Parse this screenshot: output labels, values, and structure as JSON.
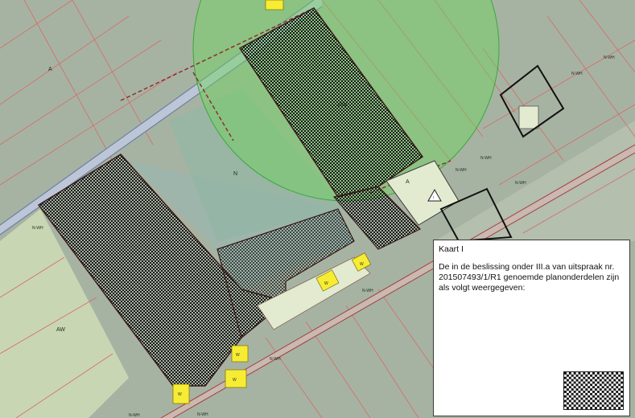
{
  "map": {
    "zone_labels": [
      {
        "id": "a-top-left",
        "text": "A"
      },
      {
        "id": "a-parcel",
        "text": "A"
      },
      {
        "id": "n-center",
        "text": "N"
      },
      {
        "id": "aw-left",
        "text": "AW"
      },
      {
        "id": "aw-upper",
        "text": "AW"
      },
      {
        "id": "nwh-top-right",
        "text": "N-WH"
      },
      {
        "id": "nwh-right",
        "text": "N-WH"
      },
      {
        "id": "nwh-mid1",
        "text": "N-WH"
      },
      {
        "id": "nwh-mid2",
        "text": "N-WH"
      },
      {
        "id": "nwh-far-right",
        "text": "N-WH"
      },
      {
        "id": "nwh-left",
        "text": "N-WH"
      },
      {
        "id": "nwh-road",
        "text": "N-WH"
      },
      {
        "id": "nwh-bottom",
        "text": "N-WH"
      },
      {
        "id": "nwh-bottom2",
        "text": "N-WH"
      },
      {
        "id": "nwh-bottom3",
        "text": "N-WH"
      },
      {
        "id": "w-1",
        "text": "W"
      },
      {
        "id": "w-2",
        "text": "W"
      },
      {
        "id": "w-3",
        "text": "W"
      },
      {
        "id": "w-4",
        "text": "W"
      },
      {
        "id": "w-5",
        "text": "W"
      }
    ],
    "colors": {
      "background": "#a7b3a2",
      "agri_area": "#c9d6b3",
      "nature_area": "#9db5ab",
      "buffer_circle": "#6cd45a",
      "residential": "#f6ec34",
      "parcel_pale": "#e2ead0",
      "parcel_lines": "#d36b6b",
      "hatch": "#1a1a1a"
    }
  },
  "legend": {
    "title": "Kaart I",
    "text": "De in de beslissing onder III.a van uitspraak nr. 201507493/1/R1 genoemde planonderdelen zijn als volgt weergegeven:",
    "swatch_pattern": "checkerboard"
  }
}
